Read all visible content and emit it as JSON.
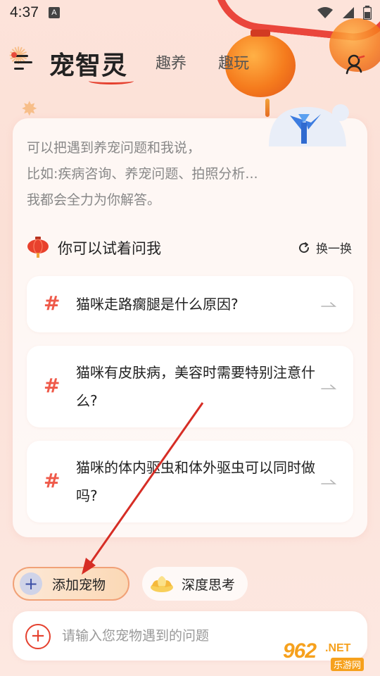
{
  "status_bar": {
    "time": "4:37",
    "notification_icon": "A"
  },
  "header": {
    "logo": "宠智灵",
    "tabs": [
      {
        "label": "趣养"
      },
      {
        "label": "趣玩"
      }
    ]
  },
  "intro": {
    "line1": "可以把遇到养宠问题和我说，",
    "line2": "比如:疾病咨询、养宠问题、拍照分析...",
    "line3": "我都会全力为你解答。"
  },
  "suggestions": {
    "title": "你可以试着问我",
    "refresh_label": "换一换",
    "items": [
      {
        "hash": "#",
        "text": "猫咪走路瘸腿是什么原因?"
      },
      {
        "hash": "#",
        "text": "猫咪有皮肤病，美容时需要特别注意什么?"
      },
      {
        "hash": "#",
        "text": "猫咪的体内驱虫和体外驱虫可以同时做吗?"
      }
    ]
  },
  "chips": {
    "add_pet": {
      "icon": "+",
      "label": "添加宠物"
    },
    "deep_think": {
      "label": "深度思考"
    }
  },
  "input": {
    "plus": "+",
    "placeholder": "请输入您宠物遇到的问题",
    "value": ""
  },
  "watermark": {
    "brand": "962",
    "net": ".NET",
    "sub": "乐游网"
  },
  "colors": {
    "accent_red": "#e5412f",
    "hash_red": "#ef5a4a",
    "chip_border": "#f1a177",
    "watermark_orange": "#f6a11d"
  }
}
